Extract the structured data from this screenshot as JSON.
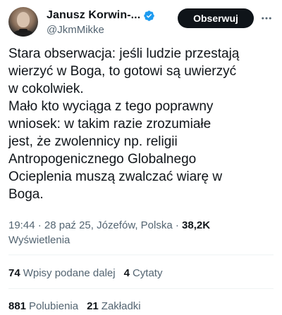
{
  "author": {
    "display_name": "Janusz Korwin-...",
    "handle": "@JkmMikke",
    "verified": true
  },
  "header": {
    "follow_label": "Obserwuj"
  },
  "tweet": {
    "text": "Stara obserwacja: jeśli ludzie przestają\nwierzyć w Boga, to gotowi są uwierzyć\nw cokolwiek.\nMało kto wyciąga z tego poprawny\nwniosek: w takim razie zrozumiałe\njest, że zwolennicy np. religii\nAntropogenicznego Globalnego\nOcieplenia muszą zwalczać wiarę w\nBoga."
  },
  "meta": {
    "time": "19:44",
    "date": "28 paź 25",
    "location": "Józefów, Polska",
    "views_count": "38,2K",
    "views_label": "Wyświetlenia"
  },
  "stats": {
    "reposts_count": "74",
    "reposts_label": "Wpisy podane dalej",
    "quotes_count": "4",
    "quotes_label": "Cytaty",
    "likes_count": "881",
    "likes_label": "Polubienia",
    "bookmarks_count": "21",
    "bookmarks_label": "Zakładki"
  },
  "icons": {
    "verified": "verified-badge-icon",
    "more": "more-options-icon"
  },
  "colors": {
    "text_primary": "#0f1419",
    "text_secondary": "#536471",
    "verified_blue": "#1d9bf0",
    "divider": "#eff3f4",
    "button_bg": "#0f1419"
  }
}
